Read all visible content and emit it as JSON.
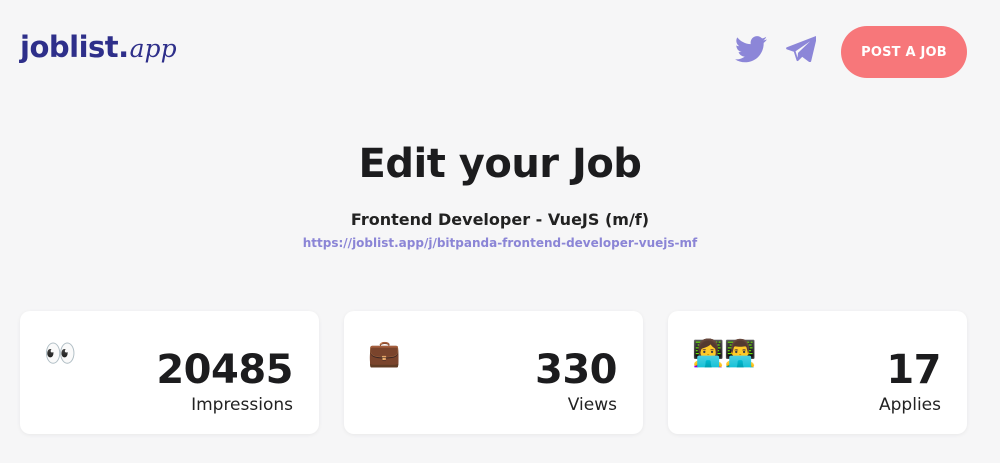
{
  "header": {
    "logo_main": "joblist.",
    "logo_sub": "app",
    "twitter_icon": "twitter-bird-icon",
    "telegram_icon": "telegram-paper-plane-icon",
    "post_button_label": "POST A JOB",
    "icon_color": "#8c86d8",
    "accent_color": "#f7777a"
  },
  "main": {
    "title": "Edit your Job",
    "job_name": "Frontend Developer - VueJS (m/f)",
    "job_url": "https://joblist.app/j/bitpanda-frontend-developer-vuejs-mf"
  },
  "stats": [
    {
      "emoji": "👀",
      "icon": "eyes-icon",
      "value": "20485",
      "label": "Impressions"
    },
    {
      "emoji": "💼",
      "icon": "briefcase-icon",
      "value": "330",
      "label": "Views"
    },
    {
      "emoji": "👩‍💻👨‍💻",
      "icon": "technologists-icon",
      "value": "17",
      "label": "Applies"
    }
  ]
}
